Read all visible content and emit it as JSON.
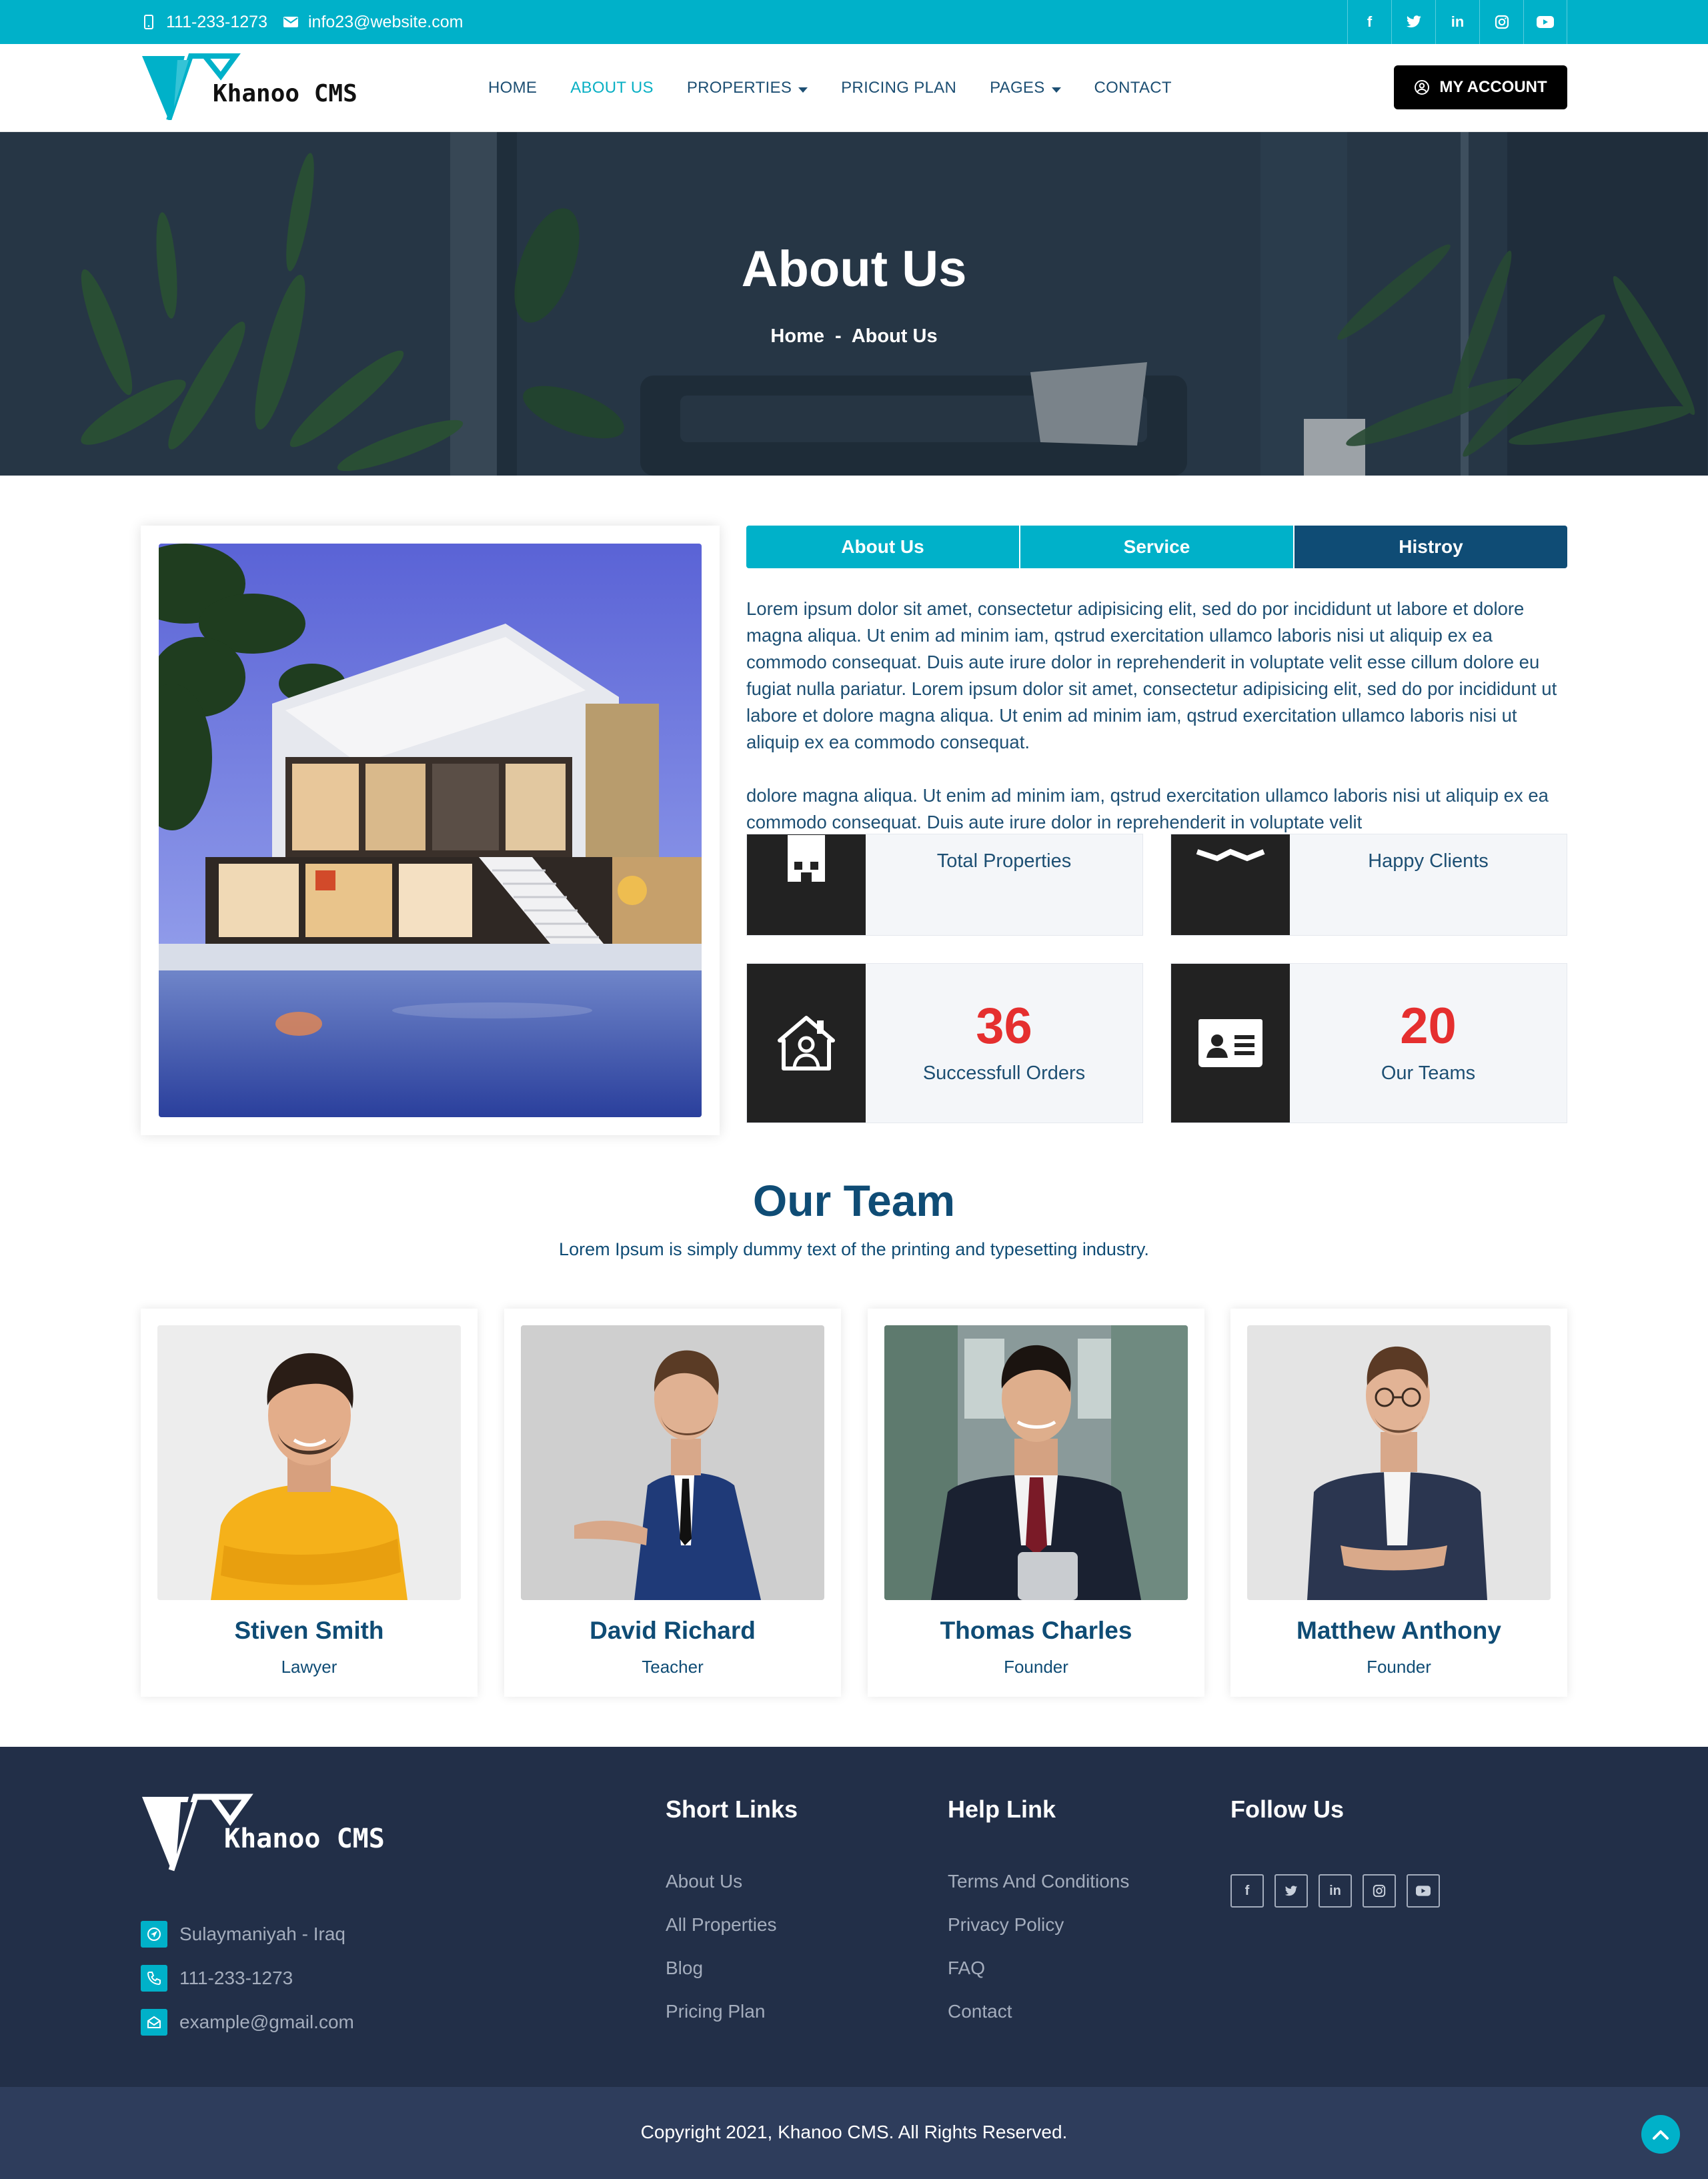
{
  "topbar": {
    "phone": "111-233-1273",
    "email": "info23@website.com",
    "socials": [
      "facebook-icon",
      "twitter-icon",
      "linkedin-icon",
      "instagram-icon",
      "youtube-icon"
    ]
  },
  "brand": {
    "name": "Khanoo CMS"
  },
  "nav": {
    "items": [
      {
        "label": "HOME"
      },
      {
        "label": "ABOUT US"
      },
      {
        "label": "PROPERTIES"
      },
      {
        "label": "PRICING PLAN"
      },
      {
        "label": "PAGES"
      },
      {
        "label": "CONTACT"
      }
    ],
    "account_label": "MY ACCOUNT"
  },
  "hero": {
    "title": "About Us",
    "crumb_home": "Home",
    "crumb_sep": "-",
    "crumb_current": "About Us"
  },
  "tabs": {
    "items": [
      {
        "label": "About Us"
      },
      {
        "label": "Service"
      },
      {
        "label": "Histroy"
      }
    ],
    "paragraph_1": "Lorem ipsum dolor sit amet, consectetur adipisicing elit, sed do por incididunt ut labore et dolore magna aliqua. Ut enim ad minim iam, qstrud exercitation ullamco laboris nisi ut aliquip ex ea commodo consequat. Duis aute irure dolor in reprehenderit in voluptate velit esse cillum dolore eu fugiat nulla pariatur. Lorem ipsum dolor sit amet, consectetur adipisicing elit, sed do por incididunt ut labore et dolore magna aliqua. Ut enim ad minim iam, qstrud exercitation ullamco laboris nisi ut aliquip ex ea commodo consequat.",
    "paragraph_2": "dolore magna aliqua. Ut enim ad minim iam, qstrud exercitation ullamco laboris nisi ut aliquip ex ea commodo consequat. Duis aute irure dolor in reprehenderit in voluptate velit"
  },
  "stats": [
    {
      "label": "Total Properties",
      "icon": "building-icon"
    },
    {
      "label": "Happy Clients",
      "icon": "handshake-icon"
    },
    {
      "value": "36",
      "label": "Successfull Orders",
      "icon": "house-user-icon"
    },
    {
      "value": "20",
      "label": "Our Teams",
      "icon": "id-card-icon"
    }
  ],
  "team": {
    "title": "Our Team",
    "subtitle": "Lorem Ipsum is simply dummy text of the printing and typesetting industry.",
    "members": [
      {
        "name": "Stiven Smith",
        "role": "Lawyer"
      },
      {
        "name": "David Richard",
        "role": "Teacher"
      },
      {
        "name": "Thomas Charles",
        "role": "Founder"
      },
      {
        "name": "Matthew Anthony",
        "role": "Founder"
      }
    ]
  },
  "footer": {
    "address": "Sulaymaniyah - Iraq",
    "phone": "111-233-1273",
    "email": "example@gmail.com",
    "short_links_title": "Short Links",
    "short_links": [
      "About Us",
      "All Properties",
      "Blog",
      "Pricing Plan"
    ],
    "help_title": "Help Link",
    "help_links": [
      "Terms And Conditions",
      "Privacy Policy",
      "FAQ",
      "Contact"
    ],
    "follow_title": "Follow Us",
    "copyright": "Copyright 2021, Khanoo CMS. All Rights Reserved."
  },
  "colors": {
    "accent": "#00b1c9",
    "navy": "#0f4c75",
    "footer": "#222f48",
    "stat_number": "#e52f2f"
  }
}
